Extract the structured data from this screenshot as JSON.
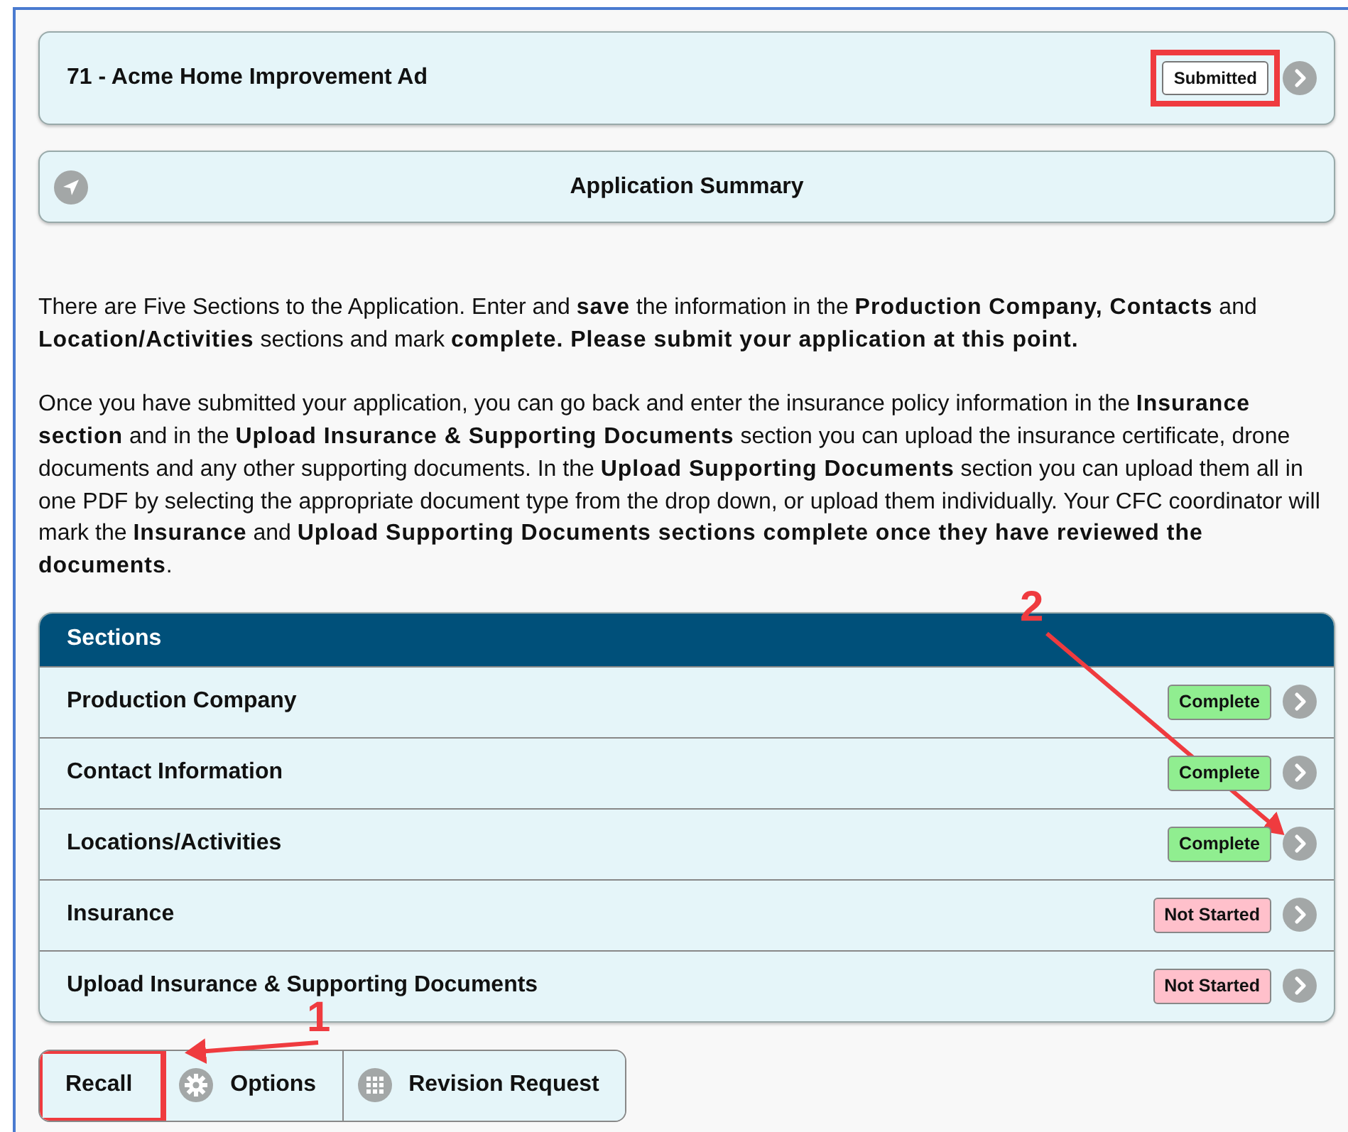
{
  "application": {
    "title": "71 - Acme Home Improvement Ad",
    "status": "Submitted",
    "status_highlighted": true
  },
  "summary": {
    "title": "Application Summary"
  },
  "intro": [
    "There are Five Sections to the Application. Enter and **save** the information in the **Production Company, Contacts** and **Location/Activities** sections and mark **complete. Please submit your application at this point.**",
    "Once you have submitted your application, you can go back and enter the insurance policy information in the **Insurance section** and in the **Upload Insurance & Supporting Documents** section you can upload the insurance certificate, drone documents and any other supporting documents. In the **Upload Supporting Documents** section you can upload them all in one PDF by selecting the appropriate document type from the drop down, or upload them individually. Your CFC coordinator will mark the **Insurance** and **Upload Supporting Documents sections complete once they have reviewed the documents**."
  ],
  "sections": {
    "title": "Sections",
    "rows": [
      {
        "name": "Production Company",
        "status": "Complete",
        "kind": "complete"
      },
      {
        "name": "Contact Information",
        "status": "Complete",
        "kind": "complete"
      },
      {
        "name": "Locations/Activities",
        "status": "Complete",
        "kind": "complete"
      },
      {
        "name": "Insurance",
        "status": "Not Started",
        "kind": "not_started"
      },
      {
        "name": "Upload Insurance & Supporting Documents",
        "status": "Not Started",
        "kind": "not_started"
      }
    ]
  },
  "buttons": [
    {
      "label": "Recall",
      "highlighted": true
    },
    {
      "label": "Options",
      "highlighted": false
    },
    {
      "label": "Revision Request",
      "highlighted": false
    }
  ],
  "annotations": [
    {
      "label": "1"
    },
    {
      "label": "2"
    }
  ]
}
